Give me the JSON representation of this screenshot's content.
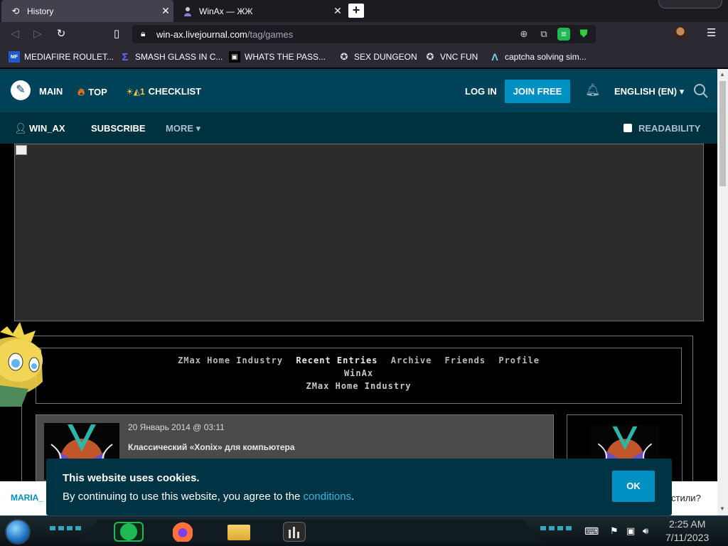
{
  "browser": {
    "tabs": [
      {
        "title": "History",
        "icon": "history-icon",
        "active": true
      },
      {
        "title": "WinAx — ЖЖ",
        "icon": "user-favicon",
        "active": false
      }
    ],
    "new_tab_label": "+",
    "url_host": "win-ax.livejournal.com",
    "url_path": "/tag/games",
    "bookmarks": [
      {
        "label": "MEDIAFIRE ROULET...",
        "icon_text": "MF"
      },
      {
        "label": "SMASH GLASS IN C...",
        "icon_text": "Σ"
      },
      {
        "label": "WHATS THE PASS...",
        "icon_text": "▣"
      },
      {
        "label": "SEX DUNGEON",
        "icon_text": "✪"
      },
      {
        "label": "VNC FUN",
        "icon_text": "✪"
      },
      {
        "label": "captcha solving sim...",
        "icon_text": "Λ"
      }
    ]
  },
  "lj": {
    "nav": {
      "main": "MAIN",
      "top": "TOP",
      "checklist": "CHECKLIST",
      "checklist_icon_text": "☀◭1",
      "login": "LOG IN",
      "join": "JOIN FREE",
      "language": "ENGLISH (EN) ▾"
    },
    "subnav": {
      "user": "WIN_AX",
      "subscribe": "SUBSCRIBE",
      "more": "MORE ▾",
      "readability": "READABILITY"
    }
  },
  "journal": {
    "links": [
      "ZMax Home Industry",
      "Recent Entries",
      "Archive",
      "Friends",
      "Profile"
    ],
    "current_link_index": 1,
    "name": "WinAx",
    "title": "ZMax Home Industry",
    "entry": {
      "date": "20 Январь 2014 @ 03:11",
      "title": "Классический «Xonix» для компьютера"
    }
  },
  "cookie": {
    "title": "This website uses cookies.",
    "text_before": "By continuing to use this website, you agree to the ",
    "link": "conditions",
    "text_after": ".",
    "ok": "OK"
  },
  "under_bar": {
    "left": "MARIA_",
    "right": "стили?"
  },
  "taskbar": {
    "time": "2:25 AM",
    "date": "7/11/2023"
  },
  "colors": {
    "lj_header": "#004359",
    "lj_subheader": "#00313f",
    "lj_accent": "#0090c1",
    "cookie_bg": "#003344"
  }
}
